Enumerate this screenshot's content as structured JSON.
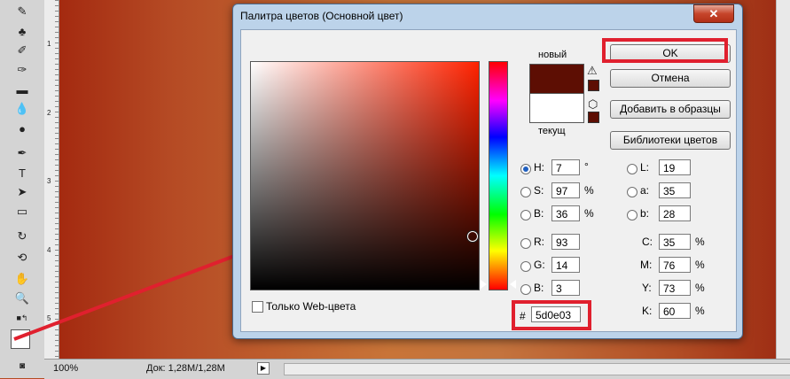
{
  "dialog": {
    "title": "Палитра цветов (Основной цвет)",
    "close_label": "✕",
    "new_label": "новый",
    "current_label": "текущ",
    "web_only_label": "Только Web-цвета",
    "buttons": {
      "ok": "OK",
      "cancel": "Отмена",
      "add_swatches": "Добавить в образцы",
      "libraries": "Библиотеки цветов"
    },
    "hsb": [
      {
        "label": "H:",
        "value": "7",
        "unit": "°"
      },
      {
        "label": "S:",
        "value": "97",
        "unit": "%"
      },
      {
        "label": "B:",
        "value": "36",
        "unit": "%"
      }
    ],
    "rgb": [
      {
        "label": "R:",
        "value": "93"
      },
      {
        "label": "G:",
        "value": "14"
      },
      {
        "label": "B:",
        "value": "3"
      }
    ],
    "lab": [
      {
        "label": "L:",
        "value": "19"
      },
      {
        "label": "a:",
        "value": "35"
      },
      {
        "label": "b:",
        "value": "28"
      }
    ],
    "cmyk": [
      {
        "label": "C:",
        "value": "35",
        "unit": "%"
      },
      {
        "label": "M:",
        "value": "76",
        "unit": "%"
      },
      {
        "label": "Y:",
        "value": "73",
        "unit": "%"
      },
      {
        "label": "K:",
        "value": "60",
        "unit": "%"
      }
    ],
    "hex_label": "#",
    "hex_value": "5d0e03",
    "selected_mode": "H"
  },
  "colors": {
    "new_color": "#5d0e03",
    "current_color": "#ffffff",
    "annotation_red": "#e0202e"
  },
  "status": {
    "zoom": "100%",
    "doc": "Док: 1,28M/1,28M"
  },
  "ruler": [
    "1",
    "2",
    "3",
    "4",
    "5"
  ],
  "tools": [
    "brush-icon",
    "stamp-icon",
    "history-brush-icon",
    "eraser-icon",
    "gradient-icon",
    "blur-icon",
    "dodge-icon",
    "pen-icon",
    "type-icon",
    "path-select-icon",
    "shape-icon",
    "3d-rotate-icon",
    "3d-orbit-icon",
    "hand-icon",
    "zoom-icon"
  ]
}
